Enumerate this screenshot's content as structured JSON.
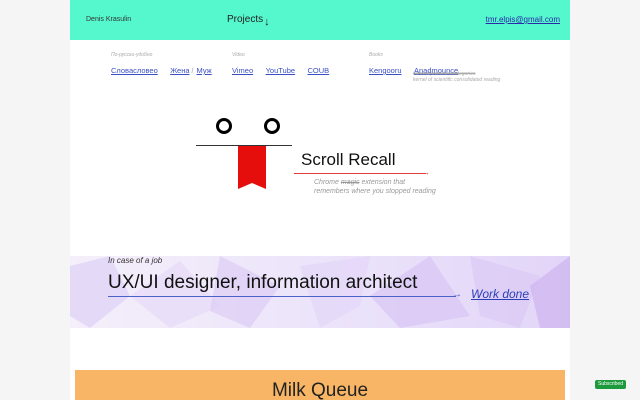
{
  "header": {
    "owner": "Denis Krasulin",
    "projects": "Projects",
    "projects_arrow": "↓",
    "email": "tmr.elpis@gmail.com"
  },
  "link_groups": [
    {
      "label": "По-русски-удобно",
      "links": [
        "Словасловео",
        "Жена",
        "Муж"
      ]
    },
    {
      "label": "Video",
      "links": [
        "Vimeo",
        "YouTube",
        "COUB"
      ]
    },
    {
      "label": "Books",
      "links": [
        "Kengooru",
        "Anadmounce"
      ]
    }
  ],
  "side_note": {
    "line1": "someobjectsclasscategories",
    "line2": "kernel of scientific consolidated reading"
  },
  "scroll_recall": {
    "title": "Scroll Recall",
    "arrow": "→",
    "desc_line1_start": "Chrome",
    "desc_line1_strike": "magic",
    "desc_line1_end": "extension that",
    "desc_line2": "remembers where you stopped reading"
  },
  "job": {
    "label": "In case of a job",
    "title": "UX/UI designer, information architect",
    "arrow": "→",
    "work_done": "Work done"
  },
  "milk_queue": {
    "title": "Milk Queue"
  },
  "badge": {
    "label": "Subscribed"
  },
  "colors": {
    "accent_mint": "#55f7cd",
    "tongue_red": "#e60d0d",
    "link_blue": "#3a4fc4",
    "milk_orange": "#f8b565",
    "badge_green": "#1d9a3d"
  }
}
